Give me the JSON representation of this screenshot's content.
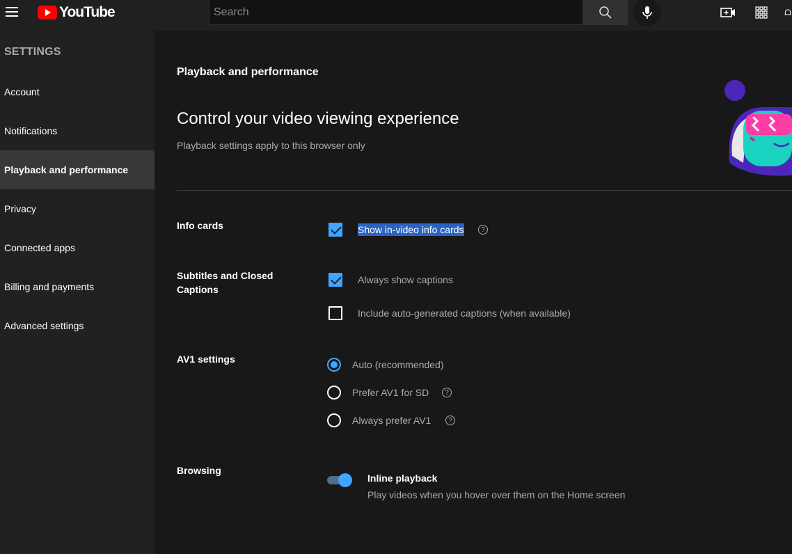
{
  "header": {
    "logo_text": "YouTube",
    "search_placeholder": "Search",
    "colors": {
      "brand": "#ff0000",
      "accent": "#3ea6ff"
    }
  },
  "sidebar": {
    "heading": "SETTINGS",
    "items": [
      {
        "label": "Account",
        "active": false
      },
      {
        "label": "Notifications",
        "active": false
      },
      {
        "label": "Playback and performance",
        "active": true
      },
      {
        "label": "Privacy",
        "active": false
      },
      {
        "label": "Connected apps",
        "active": false
      },
      {
        "label": "Billing and payments",
        "active": false
      },
      {
        "label": "Advanced settings",
        "active": false
      }
    ]
  },
  "main": {
    "section_title": "Playback and performance",
    "headline": "Control your video viewing experience",
    "subline": "Playback settings apply to this browser only",
    "info_cards": {
      "label": "Info cards",
      "option": "Show in-video info cards",
      "checked": true
    },
    "subtitles": {
      "label": "Subtitles and Closed Captions",
      "options": [
        {
          "label": "Always show captions",
          "checked": true
        },
        {
          "label": "Include auto-generated captions (when available)",
          "checked": false
        }
      ]
    },
    "av1": {
      "label": "AV1 settings",
      "options": [
        {
          "label": "Auto (recommended)",
          "selected": true
        },
        {
          "label": "Prefer AV1 for SD",
          "selected": false
        },
        {
          "label": "Always prefer AV1",
          "selected": false
        }
      ]
    },
    "browsing": {
      "label": "Browsing",
      "toggle_title": "Inline playback",
      "toggle_desc": "Play videos when you hover over them on the Home screen",
      "enabled": true
    },
    "help_glyph": "?"
  }
}
